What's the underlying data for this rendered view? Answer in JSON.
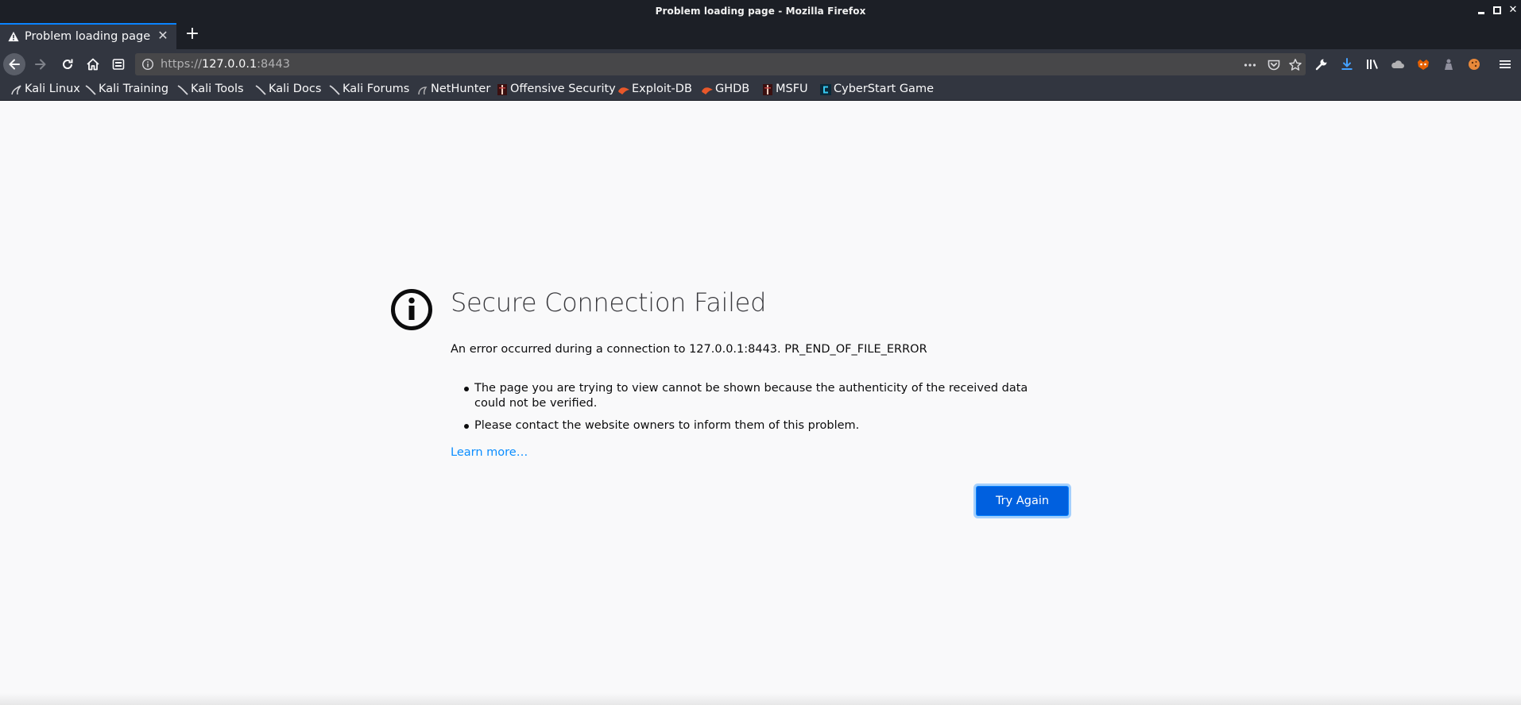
{
  "window": {
    "title": "Problem loading page - Mozilla Firefox"
  },
  "tabs": [
    {
      "title": "Problem loading page",
      "icon": "warning-icon"
    }
  ],
  "navbar": {
    "url_prefix": "https://",
    "url_host": "127.0.0.1",
    "url_port": ":8443"
  },
  "bookmarks": [
    {
      "label": "Kali Linux",
      "icon": "kali-dragon-icon"
    },
    {
      "label": "Kali Training",
      "icon": "kali-dragon-icon"
    },
    {
      "label": "Kali Tools",
      "icon": "kali-dragon-icon"
    },
    {
      "label": "Kali Docs",
      "icon": "kali-dragon-icon"
    },
    {
      "label": "Kali Forums",
      "icon": "kali-dragon-icon"
    },
    {
      "label": "NetHunter",
      "icon": "nethunter-icon"
    },
    {
      "label": "Offensive Security",
      "icon": "offsec-icon"
    },
    {
      "label": "Exploit-DB",
      "icon": "exploitdb-icon"
    },
    {
      "label": "GHDB",
      "icon": "exploitdb-icon"
    },
    {
      "label": "MSFU",
      "icon": "offsec-icon"
    },
    {
      "label": "CyberStart Game",
      "icon": "cyberstart-icon"
    }
  ],
  "error": {
    "title": "Secure Connection Failed",
    "description": "An error occurred during a connection to 127.0.0.1:8443. PR_END_OF_FILE_ERROR",
    "bullets": [
      "The page you are trying to view cannot be shown because the authenticity of the received data could not be verified.",
      "Please contact the website owners to inform them of this problem."
    ],
    "learn_more": "Learn more…",
    "try_again": "Try Again"
  },
  "colors": {
    "chrome_dark": "#1c1f26",
    "toolbar": "#323640",
    "accent": "#0a84ff",
    "button": "#0060df",
    "link": "#0a8dff"
  }
}
